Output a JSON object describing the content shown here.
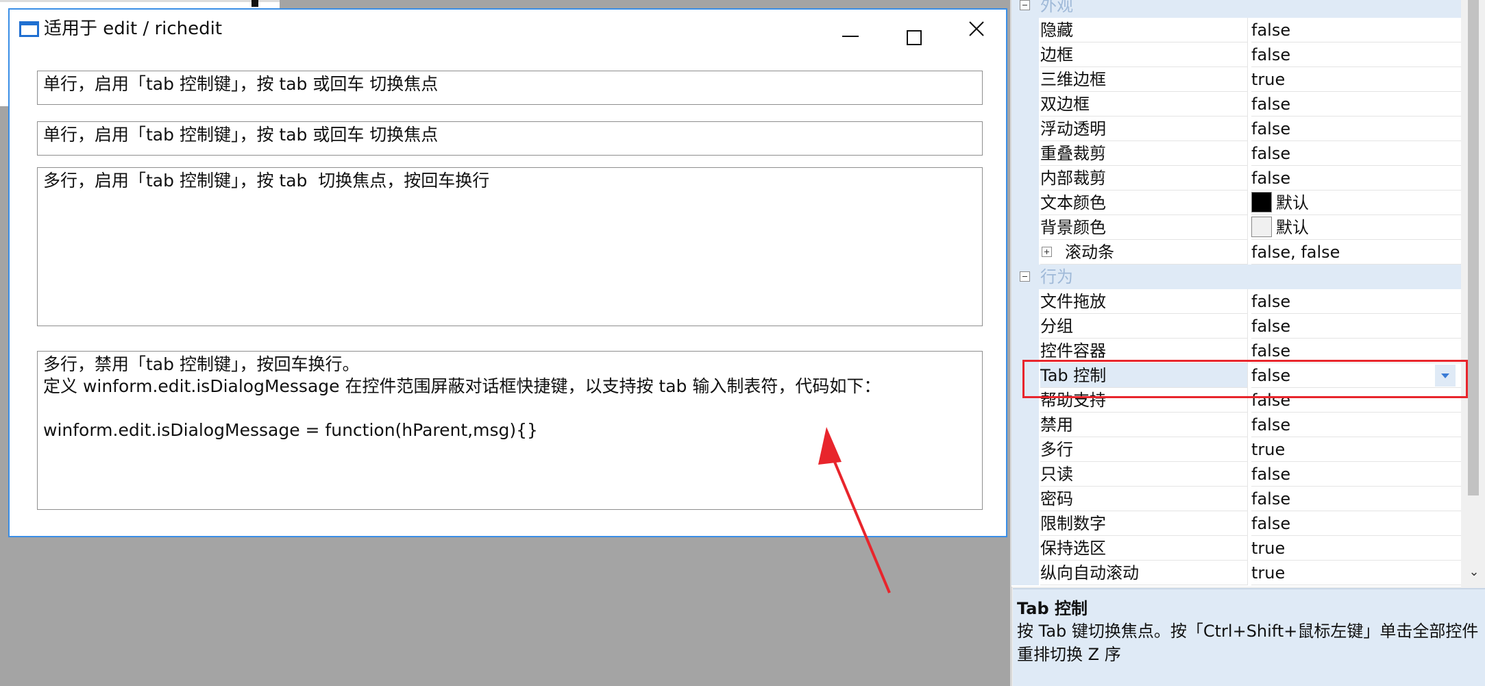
{
  "form": {
    "title": "适用于 edit / richedit",
    "edit1": "单行，启用「tab 控制键」，按 tab 或回车 切换焦点",
    "edit2": "单行，启用「tab 控制键」，按 tab 或回车 切换焦点",
    "edit3": "多行，启用「tab 控制键」，按 tab  切换焦点，按回车换行",
    "edit4": {
      "line1": "多行，禁用「tab 控制键」，按回车换行。",
      "line2": "定义 winform.edit.isDialogMessage 在控件范围屏蔽对话框快捷键，以支持按 tab 输入制表符，代码如下：",
      "line3": "",
      "line4": "winform.edit.isDialogMessage = function(hParent,msg){}"
    }
  },
  "property_grid": {
    "categories": {
      "appearance": "外观",
      "behavior": "行为"
    },
    "rows": [
      {
        "name": "隐藏",
        "value": "false"
      },
      {
        "name": "边框",
        "value": "false"
      },
      {
        "name": "三维边框",
        "value": "true"
      },
      {
        "name": "双边框",
        "value": "false"
      },
      {
        "name": "浮动透明",
        "value": "false"
      },
      {
        "name": "重叠裁剪",
        "value": "false"
      },
      {
        "name": "内部裁剪",
        "value": "false"
      },
      {
        "name": "文本颜色",
        "value": "默认"
      },
      {
        "name": "背景颜色",
        "value": "默认"
      },
      {
        "name": "滚动条",
        "value": "false, false"
      },
      {
        "name": "文件拖放",
        "value": "false"
      },
      {
        "name": "分组",
        "value": "false"
      },
      {
        "name": "控件容器",
        "value": "false"
      },
      {
        "name": "Tab 控制",
        "value": "false"
      },
      {
        "name": "帮助支持",
        "value": "false"
      },
      {
        "name": "禁用",
        "value": "false"
      },
      {
        "name": "多行",
        "value": "true"
      },
      {
        "name": "只读",
        "value": "false"
      },
      {
        "name": "密码",
        "value": "false"
      },
      {
        "name": "限制数字",
        "value": "false"
      },
      {
        "name": "保持选区",
        "value": "true"
      },
      {
        "name": "纵向自动滚动",
        "value": "true"
      }
    ],
    "text_color": "#000000",
    "back_color": "#f0f0f0"
  },
  "help": {
    "title": "Tab 控制",
    "description": "按 Tab 键切换焦点。按「Ctrl+Shift+鼠标左键」单击全部控件重排切换 Z 序"
  },
  "colors": {
    "highlight": "#e8252c",
    "category_bg": "#dfeaf6",
    "window_border": "#3a8ee6"
  }
}
